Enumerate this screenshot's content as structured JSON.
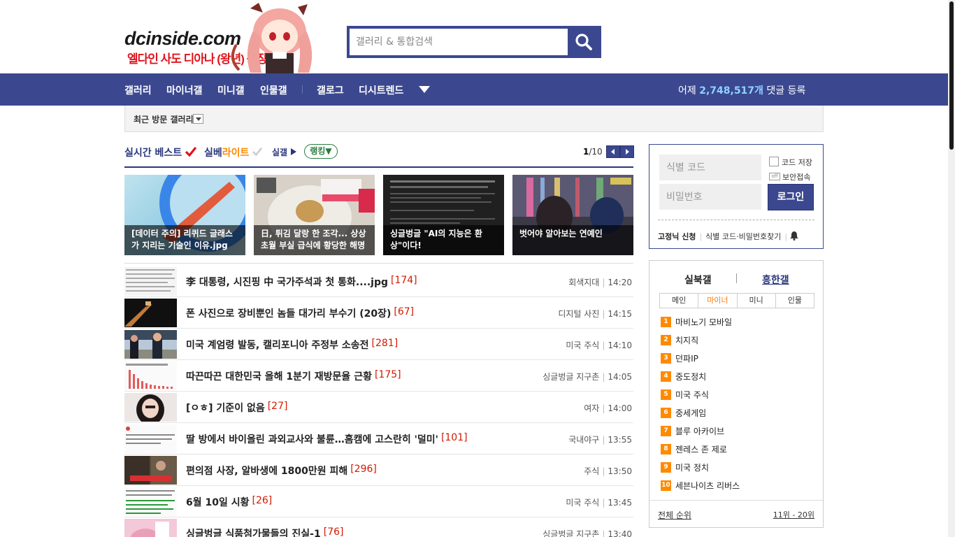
{
  "header": {
    "logo": "dcinside.com",
    "banner": "엘다인 사도 디아나 (왕년) 등장!",
    "search_placeholder": "갤러리 & 통합검색"
  },
  "nav": {
    "items": [
      "갤러리",
      "마이너갤",
      "미니갤",
      "인물갤",
      "갤로그",
      "디시트렌드"
    ],
    "stat_prefix": "어제",
    "stat_value": "2,748,517개",
    "stat_suffix": "댓글 등록"
  },
  "recent": {
    "label": "최근 방문 갤러리"
  },
  "tabs": {
    "realtime": "실시간 베스트",
    "silbe_a": "실베",
    "silbe_b": "라이트",
    "silgal": "실갤",
    "ranking": "랭킹",
    "page_current": "1",
    "page_total": "/10"
  },
  "cards": [
    {
      "caption": "[데이터 주의] 리퀴드 글래스가 지리는 기술인 이유.jpg"
    },
    {
      "caption": "日, 튀김 달랑 한 조각... 상상초월 부실 급식에 황당한 해명"
    },
    {
      "caption": "싱글벙글 \"AI의 지능은 환상\"이다!"
    },
    {
      "caption": "벗어야 알아보는 연예인"
    }
  ],
  "rows": [
    {
      "title": "李 대통령, 시진핑 中 국가주석과 첫 통화....jpg",
      "count": "[174]",
      "gallery": "회색지대",
      "time": "14:20"
    },
    {
      "title": "폰 사진으로 장비뿐인 놈들 대가리 부수기 (20장)",
      "count": "[67]",
      "gallery": "디지털 사진",
      "time": "14:15"
    },
    {
      "title": "미국 계엄령 발동, 캘리포니아 주정부 소송전",
      "count": "[281]",
      "gallery": "미국 주식",
      "time": "14:10"
    },
    {
      "title": "따끈따끈 대한민국 올해 1분기 재방문율 근황",
      "count": "[175]",
      "gallery": "싱글벙글 지구촌",
      "time": "14:05"
    },
    {
      "title": "[ㅇㅎ] 기준이 없음",
      "count": "[27]",
      "gallery": "여자",
      "time": "14:00"
    },
    {
      "title": "딸 방에서 바이올린 과외교사와 불륜…홈캠에 고스란히 '덜미'",
      "count": "[101]",
      "gallery": "국내야구",
      "time": "13:55"
    },
    {
      "title": "편의점 사장, 알바생에 1800만원 피해",
      "count": "[296]",
      "gallery": "주식",
      "time": "13:50"
    },
    {
      "title": "6월 10일 시황",
      "count": "[26]",
      "gallery": "미국 주식",
      "time": "13:45"
    },
    {
      "title": "싱글벙글 식품첨가물들의 진실-1",
      "count": "[76]",
      "gallery": "싱글벙글 지구촌",
      "time": "13:40"
    }
  ],
  "login": {
    "id_placeholder": "식별 코드",
    "pw_placeholder": "비밀번호",
    "save_code": "코드 저장",
    "toggle_off": "off",
    "secure": "보안접속",
    "button": "로그인",
    "signup": "고정닉 신청",
    "find": "식별 코드·비밀번호찾기"
  },
  "ranking": {
    "tab_a": "실북갤",
    "tab_b": "흥한갤",
    "subtabs": [
      "메인",
      "마이너",
      "미니",
      "인물"
    ],
    "active_subtab": "마이너",
    "items": [
      "마비노기 모바일",
      "치지직",
      "던파IP",
      "중도정치",
      "미국 주식",
      "중세게임",
      "블루 아카이브",
      "젠레스 존 제로",
      "미국 정치",
      "세븐나이츠 리버스"
    ],
    "all": "전체 순위",
    "next": "11위 - 20위"
  },
  "colors": {
    "brand": "#3b4890",
    "accent": "#ff8a00",
    "count": "#d31900"
  }
}
